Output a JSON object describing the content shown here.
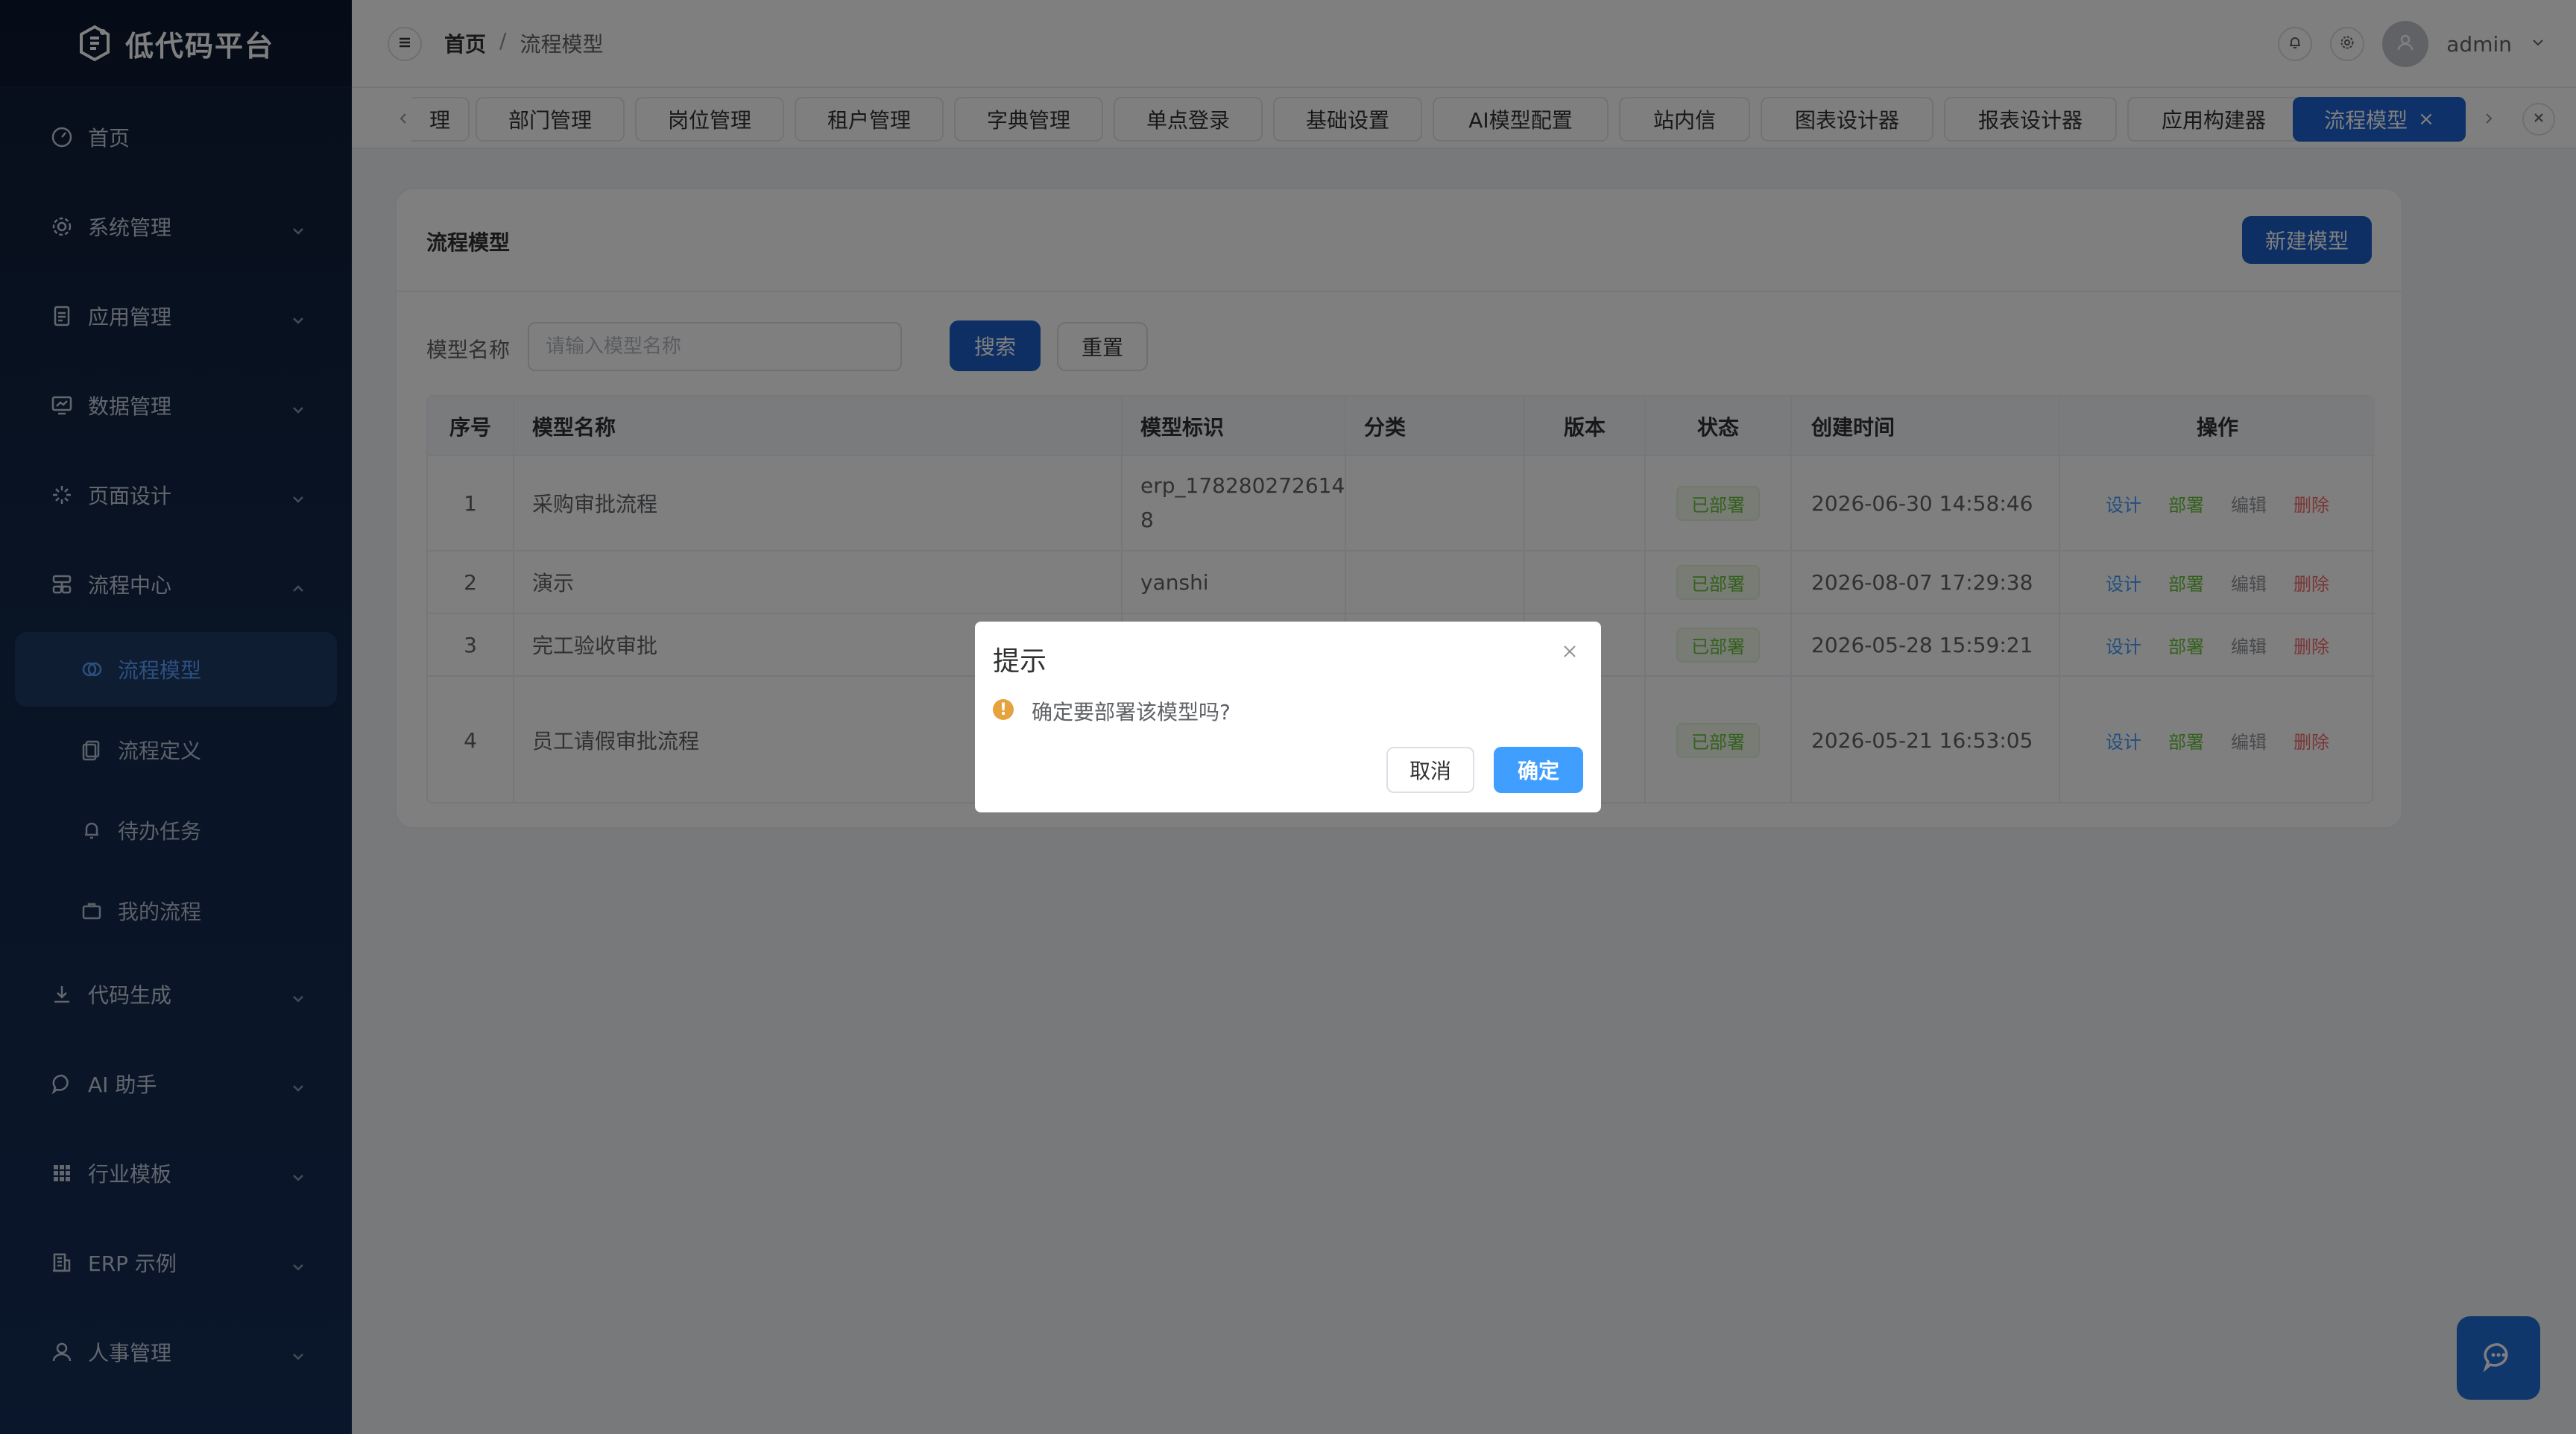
{
  "brand": {
    "title": "低代码平台"
  },
  "sidebar": {
    "items": [
      {
        "label": "首页"
      },
      {
        "label": "系统管理"
      },
      {
        "label": "应用管理"
      },
      {
        "label": "数据管理"
      },
      {
        "label": "页面设计"
      },
      {
        "label": "流程中心"
      },
      {
        "label": "代码生成"
      },
      {
        "label": "AI 助手"
      },
      {
        "label": "行业模板"
      },
      {
        "label": "ERP 示例"
      },
      {
        "label": "人事管理"
      }
    ],
    "subitems": [
      {
        "label": "流程模型"
      },
      {
        "label": "流程定义"
      },
      {
        "label": "待办任务"
      },
      {
        "label": "我的流程"
      }
    ]
  },
  "header": {
    "breadcrumb_home": "首页",
    "breadcrumb_sep": "/",
    "breadcrumb_current": "流程模型",
    "username": "admin"
  },
  "tabs": [
    {
      "label": "理"
    },
    {
      "label": "部门管理"
    },
    {
      "label": "岗位管理"
    },
    {
      "label": "租户管理"
    },
    {
      "label": "字典管理"
    },
    {
      "label": "单点登录"
    },
    {
      "label": "基础设置"
    },
    {
      "label": "AI模型配置"
    },
    {
      "label": "站内信"
    },
    {
      "label": "图表设计器"
    },
    {
      "label": "报表设计器"
    },
    {
      "label": "应用构建器"
    },
    {
      "label": "流程模型",
      "close": "×"
    }
  ],
  "card": {
    "title": "流程模型",
    "new_label": "新建模型"
  },
  "filter": {
    "label": "模型名称",
    "placeholder": "请输入模型名称",
    "search_label": "搜索",
    "reset_label": "重置"
  },
  "table": {
    "columns": [
      "序号",
      "模型名称",
      "模型标识",
      "分类",
      "版本",
      "状态",
      "创建时间",
      "操作"
    ],
    "rows": [
      {
        "index": "1",
        "name": "采购审批流程",
        "key_line1": "erp_178280272614",
        "key_line2": "8",
        "category": "",
        "version": "",
        "status": "已部署",
        "created": "2026-06-30 14:58:46"
      },
      {
        "index": "2",
        "name": "演示",
        "key_line1": "yanshi",
        "key_line2": "",
        "category": "",
        "version": "",
        "status": "已部署",
        "created": "2026-08-07 17:29:38"
      },
      {
        "index": "3",
        "name": "完工验收审批",
        "key_line1": "",
        "key_line2": "",
        "category": "",
        "version": "",
        "status": "已部署",
        "created": "2026-05-28 15:59:21"
      },
      {
        "index": "4",
        "name": "员工请假审批流程",
        "key_line1": "",
        "key_line2": "",
        "category": "",
        "version": "",
        "status": "已部署",
        "created": "2026-05-21 16:53:05"
      }
    ],
    "actions": {
      "design": "设计",
      "deploy": "部署",
      "edit": "编辑",
      "delete": "删除"
    }
  },
  "dialog": {
    "title": "提示",
    "close": "×",
    "warn_glyph": "!",
    "message": "确定要部署该模型吗?",
    "cancel_label": "取消",
    "confirm_label": "确定"
  },
  "colors": {
    "accent": "#1a62d0",
    "success": "#67c23a",
    "danger": "#f56c6c",
    "warning": "#e6a23c",
    "sidebar_bg": "#13284a"
  }
}
